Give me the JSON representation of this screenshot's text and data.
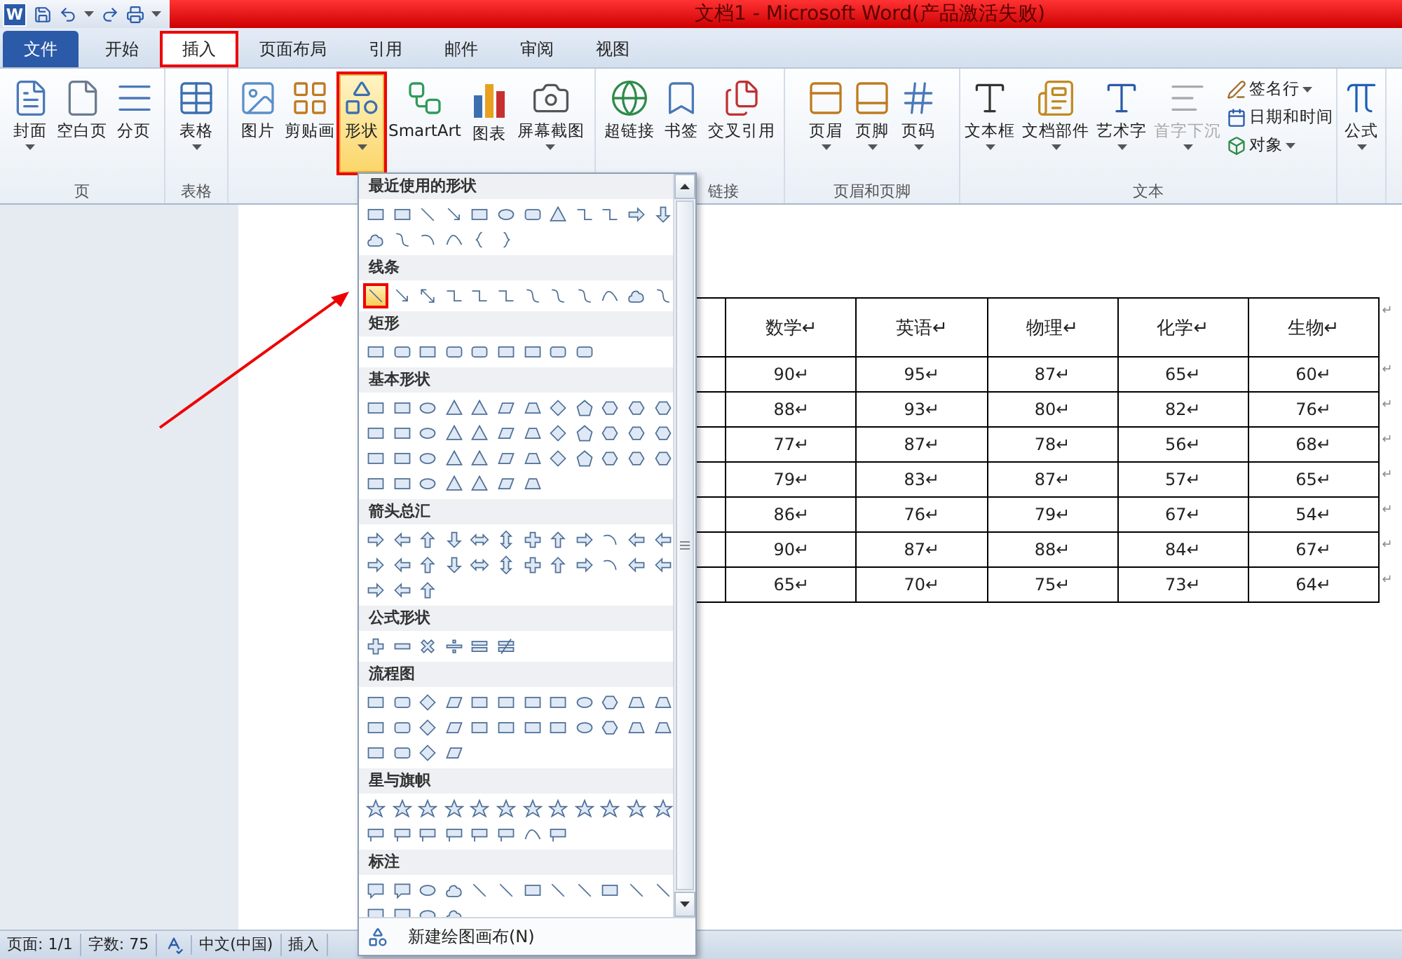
{
  "title_bar": {
    "logo": "W",
    "title": "文档1 - Microsoft Word(产品激活失败)"
  },
  "tabs": [
    {
      "label": "文件",
      "kind": "file",
      "selected": false,
      "annotated": false
    },
    {
      "label": "开始",
      "kind": "tab",
      "selected": false,
      "annotated": false
    },
    {
      "label": "插入",
      "kind": "tab",
      "selected": true,
      "annotated": true
    },
    {
      "label": "页面布局",
      "kind": "tab",
      "selected": false,
      "annotated": false
    },
    {
      "label": "引用",
      "kind": "tab",
      "selected": false,
      "annotated": false
    },
    {
      "label": "邮件",
      "kind": "tab",
      "selected": false,
      "annotated": false
    },
    {
      "label": "审阅",
      "kind": "tab",
      "selected": false,
      "annotated": false
    },
    {
      "label": "视图",
      "kind": "tab",
      "selected": false,
      "annotated": false
    }
  ],
  "ribbon": {
    "groups": [
      {
        "label": "页",
        "buttons": [
          {
            "label": "封面",
            "kind": "large",
            "has_menu": true,
            "selected": false,
            "disabled": false,
            "annotated": false
          },
          {
            "label": "空白页",
            "kind": "large",
            "has_menu": false,
            "selected": false,
            "disabled": false,
            "annotated": false
          },
          {
            "label": "分页",
            "kind": "large",
            "has_menu": false,
            "selected": false,
            "disabled": false,
            "annotated": false
          }
        ]
      },
      {
        "label": "表格",
        "buttons": [
          {
            "label": "表格",
            "kind": "large",
            "has_menu": true,
            "selected": false,
            "disabled": false,
            "annotated": false
          }
        ]
      },
      {
        "buttons": [
          {
            "label": "图片",
            "kind": "large",
            "has_menu": false,
            "selected": false,
            "disabled": false,
            "annotated": false
          },
          {
            "label": "剪贴画",
            "kind": "large",
            "has_menu": false,
            "selected": false,
            "disabled": false,
            "annotated": false
          },
          {
            "label": "形状",
            "kind": "large",
            "has_menu": true,
            "selected": true,
            "disabled": false,
            "annotated": true
          },
          {
            "label": "SmartArt",
            "kind": "large",
            "has_menu": false,
            "selected": false,
            "disabled": false,
            "annotated": false
          },
          {
            "label": "图表",
            "kind": "large",
            "has_menu": false,
            "selected": false,
            "disabled": false,
            "annotated": false
          },
          {
            "label": "屏幕截图",
            "kind": "large",
            "has_menu": true,
            "selected": false,
            "disabled": false,
            "annotated": false
          }
        ]
      },
      {
        "label": "链接",
        "buttons": [
          {
            "label": "超链接",
            "kind": "large",
            "has_menu": false,
            "selected": false,
            "disabled": false,
            "annotated": false
          },
          {
            "label": "书签",
            "kind": "large",
            "has_menu": false,
            "selected": false,
            "disabled": false,
            "annotated": false
          },
          {
            "label": "交叉引用",
            "kind": "large",
            "has_menu": false,
            "selected": false,
            "disabled": false,
            "annotated": false
          }
        ]
      },
      {
        "label": "页眉和页脚",
        "buttons": [
          {
            "label": "页眉",
            "kind": "large",
            "has_menu": true,
            "selected": false,
            "disabled": false,
            "annotated": false
          },
          {
            "label": "页脚",
            "kind": "large",
            "has_menu": true,
            "selected": false,
            "disabled": false,
            "annotated": false
          },
          {
            "label": "页码",
            "kind": "large",
            "has_menu": true,
            "selected": false,
            "disabled": false,
            "annotated": false
          }
        ]
      },
      {
        "label": "文本",
        "buttons": [
          {
            "label": "文本框",
            "kind": "large",
            "has_menu": true,
            "selected": false,
            "disabled": false,
            "annotated": false
          },
          {
            "label": "文档部件",
            "kind": "large",
            "has_menu": true,
            "selected": false,
            "disabled": false,
            "annotated": false
          },
          {
            "label": "艺术字",
            "kind": "large",
            "has_menu": true,
            "selected": false,
            "disabled": false,
            "annotated": false
          },
          {
            "label": "首字下沉",
            "kind": "large",
            "has_menu": true,
            "selected": false,
            "disabled": true,
            "annotated": false
          },
          {
            "label": "签名行",
            "kind": "small",
            "has_menu": true,
            "selected": false,
            "disabled": false,
            "annotated": false
          },
          {
            "label": "日期和时间",
            "kind": "small",
            "has_menu": false,
            "selected": false,
            "disabled": false,
            "annotated": false
          },
          {
            "label": "对象",
            "kind": "small",
            "has_menu": true,
            "selected": false,
            "disabled": false,
            "annotated": false
          }
        ]
      },
      {
        "buttons": [
          {
            "label": "公式",
            "kind": "large",
            "has_menu": true,
            "selected": false,
            "disabled": false,
            "annotated": false
          }
        ]
      }
    ]
  },
  "shapes_menu": {
    "sections": [
      {
        "title": "最近使用的形状",
        "shapes": [
          {
            "selected": false
          },
          {
            "selected": false
          },
          {
            "selected": false
          },
          {
            "selected": false
          },
          {
            "selected": false
          },
          {
            "selected": false
          },
          {
            "selected": false
          },
          {
            "selected": false
          },
          {
            "selected": false
          },
          {
            "selected": false
          },
          {
            "selected": false
          },
          {
            "selected": false
          },
          {
            "selected": false
          },
          {
            "selected": false
          },
          {
            "selected": false
          },
          {
            "selected": false
          },
          {
            "selected": false
          },
          {
            "selected": false
          }
        ]
      },
      {
        "title": "线条",
        "shapes": [
          {
            "selected": true
          },
          {
            "selected": false
          },
          {
            "selected": false
          },
          {
            "selected": false
          },
          {
            "selected": false
          },
          {
            "selected": false
          },
          {
            "selected": false
          },
          {
            "selected": false
          },
          {
            "selected": false
          },
          {
            "selected": false
          },
          {
            "selected": false
          },
          {
            "selected": false
          }
        ]
      },
      {
        "title": "矩形",
        "shapes": [
          {
            "selected": false
          },
          {
            "selected": false
          },
          {
            "selected": false
          },
          {
            "selected": false
          },
          {
            "selected": false
          },
          {
            "selected": false
          },
          {
            "selected": false
          },
          {
            "selected": false
          },
          {
            "selected": false
          }
        ]
      },
      {
        "title": "基本形状",
        "shapes": [
          {
            "selected": false
          },
          {
            "selected": false
          },
          {
            "selected": false
          },
          {
            "selected": false
          },
          {
            "selected": false
          },
          {
            "selected": false
          },
          {
            "selected": false
          },
          {
            "selected": false
          },
          {
            "selected": false
          },
          {
            "selected": false
          },
          {
            "selected": false
          },
          {
            "selected": false
          },
          {
            "selected": false
          },
          {
            "selected": false
          },
          {
            "selected": false
          },
          {
            "selected": false
          },
          {
            "selected": false
          },
          {
            "selected": false
          },
          {
            "selected": false
          },
          {
            "selected": false
          },
          {
            "selected": false
          },
          {
            "selected": false
          },
          {
            "selected": false
          },
          {
            "selected": false
          },
          {
            "selected": false
          },
          {
            "selected": false
          },
          {
            "selected": false
          },
          {
            "selected": false
          },
          {
            "selected": false
          },
          {
            "selected": false
          },
          {
            "selected": false
          },
          {
            "selected": false
          },
          {
            "selected": false
          },
          {
            "selected": false
          },
          {
            "selected": false
          },
          {
            "selected": false
          },
          {
            "selected": false
          },
          {
            "selected": false
          },
          {
            "selected": false
          },
          {
            "selected": false
          },
          {
            "selected": false
          },
          {
            "selected": false
          },
          {
            "selected": false
          }
        ]
      },
      {
        "title": "箭头总汇",
        "shapes": [
          {
            "selected": false
          },
          {
            "selected": false
          },
          {
            "selected": false
          },
          {
            "selected": false
          },
          {
            "selected": false
          },
          {
            "selected": false
          },
          {
            "selected": false
          },
          {
            "selected": false
          },
          {
            "selected": false
          },
          {
            "selected": false
          },
          {
            "selected": false
          },
          {
            "selected": false
          },
          {
            "selected": false
          },
          {
            "selected": false
          },
          {
            "selected": false
          },
          {
            "selected": false
          },
          {
            "selected": false
          },
          {
            "selected": false
          },
          {
            "selected": false
          },
          {
            "selected": false
          },
          {
            "selected": false
          },
          {
            "selected": false
          },
          {
            "selected": false
          },
          {
            "selected": false
          },
          {
            "selected": false
          },
          {
            "selected": false
          },
          {
            "selected": false
          }
        ]
      },
      {
        "title": "公式形状",
        "shapes": [
          {
            "selected": false
          },
          {
            "selected": false
          },
          {
            "selected": false
          },
          {
            "selected": false
          },
          {
            "selected": false
          },
          {
            "selected": false
          }
        ]
      },
      {
        "title": "流程图",
        "shapes": [
          {
            "selected": false
          },
          {
            "selected": false
          },
          {
            "selected": false
          },
          {
            "selected": false
          },
          {
            "selected": false
          },
          {
            "selected": false
          },
          {
            "selected": false
          },
          {
            "selected": false
          },
          {
            "selected": false
          },
          {
            "selected": false
          },
          {
            "selected": false
          },
          {
            "selected": false
          },
          {
            "selected": false
          },
          {
            "selected": false
          },
          {
            "selected": false
          },
          {
            "selected": false
          },
          {
            "selected": false
          },
          {
            "selected": false
          },
          {
            "selected": false
          },
          {
            "selected": false
          },
          {
            "selected": false
          },
          {
            "selected": false
          },
          {
            "selected": false
          },
          {
            "selected": false
          },
          {
            "selected": false
          },
          {
            "selected": false
          },
          {
            "selected": false
          },
          {
            "selected": false
          }
        ]
      },
      {
        "title": "星与旗帜",
        "shapes": [
          {
            "selected": false
          },
          {
            "selected": false
          },
          {
            "selected": false
          },
          {
            "selected": false
          },
          {
            "selected": false
          },
          {
            "selected": false
          },
          {
            "selected": false
          },
          {
            "selected": false
          },
          {
            "selected": false
          },
          {
            "selected": false
          },
          {
            "selected": false
          },
          {
            "selected": false
          },
          {
            "selected": false
          },
          {
            "selected": false
          },
          {
            "selected": false
          },
          {
            "selected": false
          },
          {
            "selected": false
          },
          {
            "selected": false
          },
          {
            "selected": false
          },
          {
            "selected": false
          }
        ]
      },
      {
        "title": "标注",
        "shapes": [
          {
            "selected": false
          },
          {
            "selected": false
          },
          {
            "selected": false
          },
          {
            "selected": false
          },
          {
            "selected": false
          },
          {
            "selected": false
          },
          {
            "selected": false
          },
          {
            "selected": false
          },
          {
            "selected": false
          },
          {
            "selected": false
          },
          {
            "selected": false
          },
          {
            "selected": false
          },
          {
            "selected": false
          },
          {
            "selected": false
          },
          {
            "selected": false
          },
          {
            "selected": false
          }
        ]
      }
    ],
    "footer": "新建绘图画布(N)"
  },
  "table": {
    "columns": [
      "数学↵",
      "英语↵",
      "物理↵",
      "化学↵",
      "生物↵"
    ],
    "rows": [
      [
        "90↵",
        "95↵",
        "87↵",
        "65↵",
        "60↵"
      ],
      [
        "88↵",
        "93↵",
        "80↵",
        "82↵",
        "76↵"
      ],
      [
        "77↵",
        "87↵",
        "78↵",
        "56↵",
        "68↵"
      ],
      [
        "79↵",
        "83↵",
        "87↵",
        "57↵",
        "65↵"
      ],
      [
        "86↵",
        "76↵",
        "79↵",
        "67↵",
        "54↵"
      ],
      [
        "90↵",
        "87↵",
        "88↵",
        "84↵",
        "67↵"
      ],
      [
        "65↵",
        "70↵",
        "75↵",
        "73↵",
        "64↵"
      ]
    ],
    "row_end_mark": "↵"
  },
  "status_bar": [
    {
      "kind": "text",
      "text": "页面: 1/1"
    },
    {
      "kind": "text",
      "text": "字数: 75"
    },
    {
      "kind": "icon"
    },
    {
      "kind": "text",
      "text": "中文(中国)"
    },
    {
      "kind": "text",
      "text": "插入"
    }
  ]
}
